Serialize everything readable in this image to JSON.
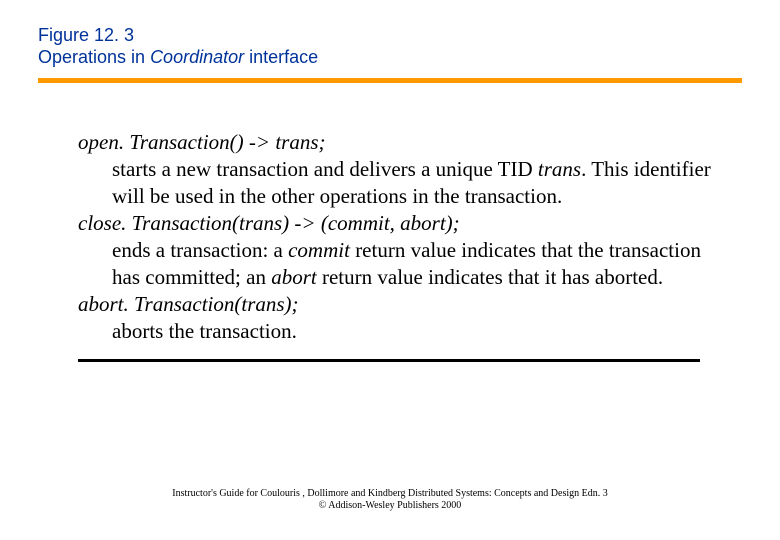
{
  "header": {
    "line1": "Figure 12. 3",
    "line2_prefix": "Operations in ",
    "line2_italic": "Coordinator",
    "line2_suffix": " interface"
  },
  "ops": {
    "open": {
      "sig": "open. Transaction() -> trans;",
      "desc_before": "starts a new transaction and delivers a unique TID ",
      "desc_kw": "trans",
      "desc_after": ". This identifier will be used in the other operations in the transaction."
    },
    "close": {
      "sig": "close. Transaction(trans) -> (commit, abort);",
      "desc_before": "ends a transaction: a ",
      "desc_kw1": "commit",
      "desc_mid": " return value indicates that the transaction has  committed; an ",
      "desc_kw2": "abort",
      "desc_after": " return value indicates that it has aborted."
    },
    "abort": {
      "sig": "abort. Transaction(trans);",
      "desc": "aborts the transaction."
    }
  },
  "footer": {
    "line1": "Instructor's Guide for  Coulouris , Dollimore and Kindberg   Distributed Systems: Concepts and Design   Edn. 3",
    "line2": "©  Addison-Wesley Publishers 2000"
  }
}
